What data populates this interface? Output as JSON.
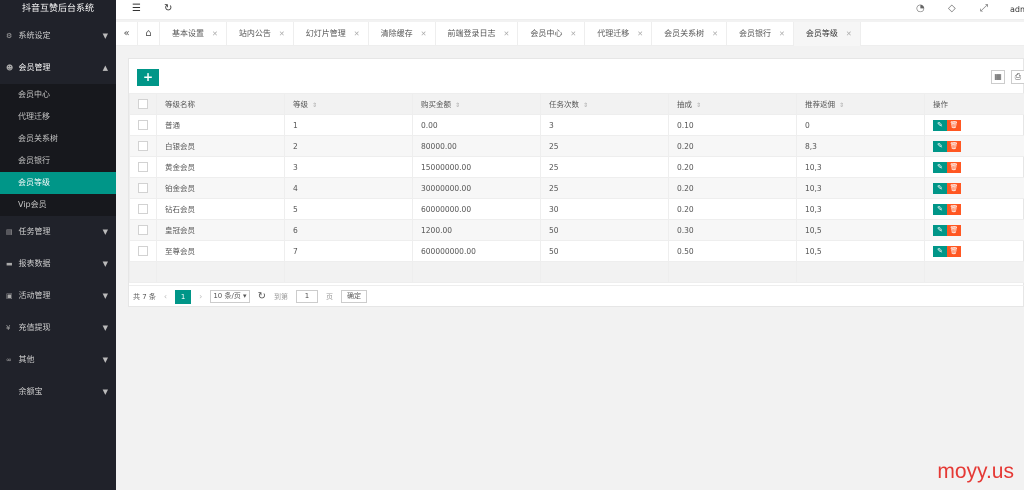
{
  "app": {
    "title": "抖音互赞后台系统",
    "user": "admin"
  },
  "sidebar": {
    "groups": [
      {
        "label": "系统设定",
        "icon": "gear-icon"
      },
      {
        "label": "会员管理",
        "icon": "user-icon",
        "open": true
      },
      {
        "label": "任务管理",
        "icon": "task-icon"
      },
      {
        "label": "报表数据",
        "icon": "chart-icon"
      },
      {
        "label": "活动管理",
        "icon": "book-icon"
      },
      {
        "label": "充值提现",
        "icon": "yen-icon"
      },
      {
        "label": "其他",
        "icon": "link-icon"
      },
      {
        "label": "余额宝",
        "icon": ""
      }
    ],
    "sub_items": [
      "会员中心",
      "代理迁移",
      "会员关系树",
      "会员银行",
      "会员等级",
      "Vip会员"
    ],
    "active_sub": "会员等级"
  },
  "tabs": [
    "基本设置",
    "站内公告",
    "幻灯片管理",
    "清除缓存",
    "前端登录日志",
    "会员中心",
    "代理迁移",
    "会员关系树",
    "会员银行",
    "会员等级"
  ],
  "active_tab": "会员等级",
  "table": {
    "columns": [
      "等级名称",
      "等级",
      "购买金额",
      "任务次数",
      "抽成",
      "推荐返佣",
      "操作"
    ],
    "rows": [
      [
        "普通",
        "1",
        "0.00",
        "3",
        "0.10",
        "0"
      ],
      [
        "白银会员",
        "2",
        "80000.00",
        "25",
        "0.20",
        "8,3"
      ],
      [
        "黄金会员",
        "3",
        "15000000.00",
        "25",
        "0.20",
        "10,3"
      ],
      [
        "铂金会员",
        "4",
        "30000000.00",
        "25",
        "0.20",
        "10,3"
      ],
      [
        "钻石会员",
        "5",
        "60000000.00",
        "30",
        "0.20",
        "10,3"
      ],
      [
        "皇冠会员",
        "6",
        "1200.00",
        "50",
        "0.30",
        "10,5"
      ],
      [
        "至尊会员",
        "7",
        "600000000.00",
        "50",
        "0.50",
        "10,5"
      ]
    ]
  },
  "pager": {
    "total": "共 7 条",
    "current": "1",
    "per_page": "10 条/页",
    "goto_label": "到第",
    "goto_value": "1",
    "page_unit": "页",
    "confirm": "确定"
  },
  "watermark": "moyy.us",
  "colors": {
    "accent": "#009688",
    "danger": "#ff5722",
    "sidebar": "#20222a"
  }
}
